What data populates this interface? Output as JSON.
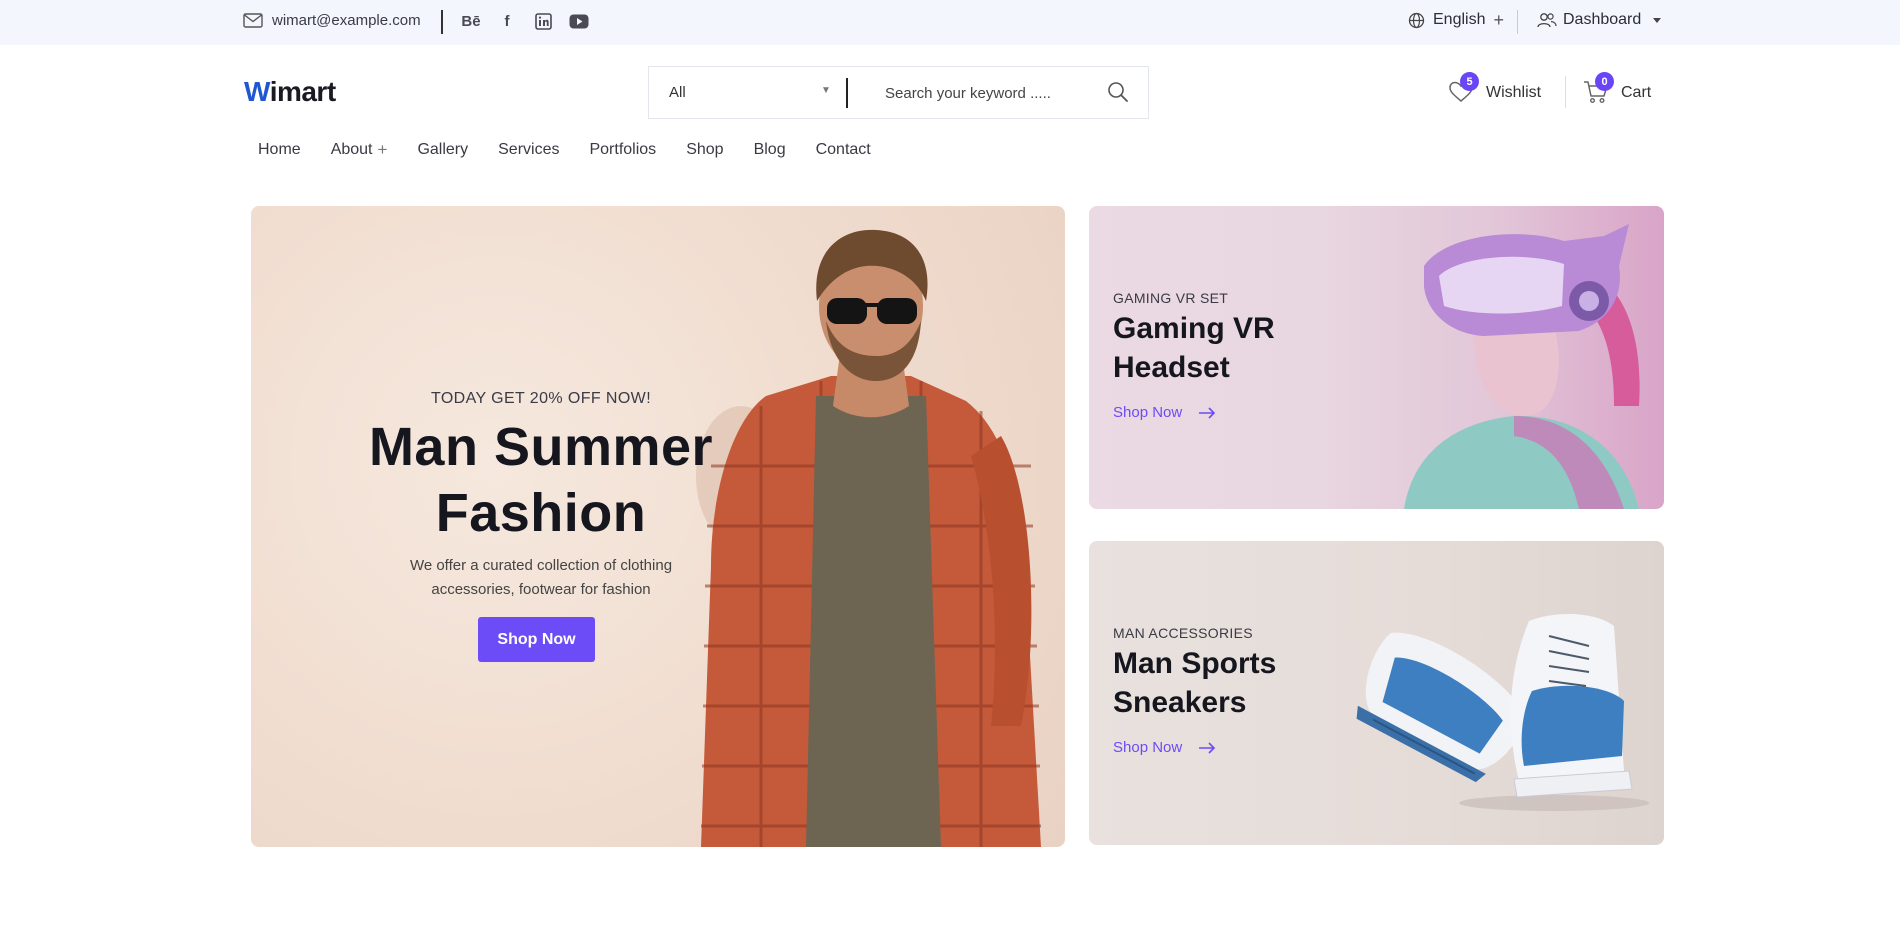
{
  "topbar": {
    "email": "wimart@example.com",
    "socials": [
      {
        "icon": "behance-icon",
        "glyph": "Bē"
      },
      {
        "icon": "facebook-icon",
        "glyph": "f"
      },
      {
        "icon": "linkedin-icon",
        "glyph": "in"
      },
      {
        "icon": "youtube-icon",
        "glyph": "▶"
      }
    ],
    "language": "English",
    "language_plus": "+",
    "account": "Dashboard"
  },
  "header": {
    "logo_part1": "W",
    "logo_part2": "imart",
    "search": {
      "category": "All",
      "placeholder": "Search your keyword ....."
    },
    "wishlist": {
      "label": "Wishlist",
      "count": "5"
    },
    "cart": {
      "label": "Cart",
      "count": "0"
    }
  },
  "nav": {
    "items": [
      "Home",
      "About",
      "Gallery",
      "Services",
      "Portfolios",
      "Shop",
      "Blog",
      "Contact"
    ],
    "about_plus": "+"
  },
  "hero": {
    "tag": "TODAY GET 20% OFF NOW!",
    "title_line1": "Man Summer",
    "title_line2": "Fashion",
    "desc_line1": "We offer a curated collection of clothing",
    "desc_line2": "accessories, footwear for fashion",
    "button": "Shop Now"
  },
  "banners": [
    {
      "kicker": "GAMING VR SET",
      "title_line1": "Gaming VR",
      "title_line2": "Headset",
      "link": "Shop Now"
    },
    {
      "kicker": "MAN ACCESSORIES",
      "title_line1": "Man Sports",
      "title_line2": "Sneakers",
      "link": "Shop Now"
    }
  ],
  "colors": {
    "accent": "#6b4cf6",
    "logo_blue": "#1f56d1",
    "topbar_bg": "#f3f6fd"
  }
}
